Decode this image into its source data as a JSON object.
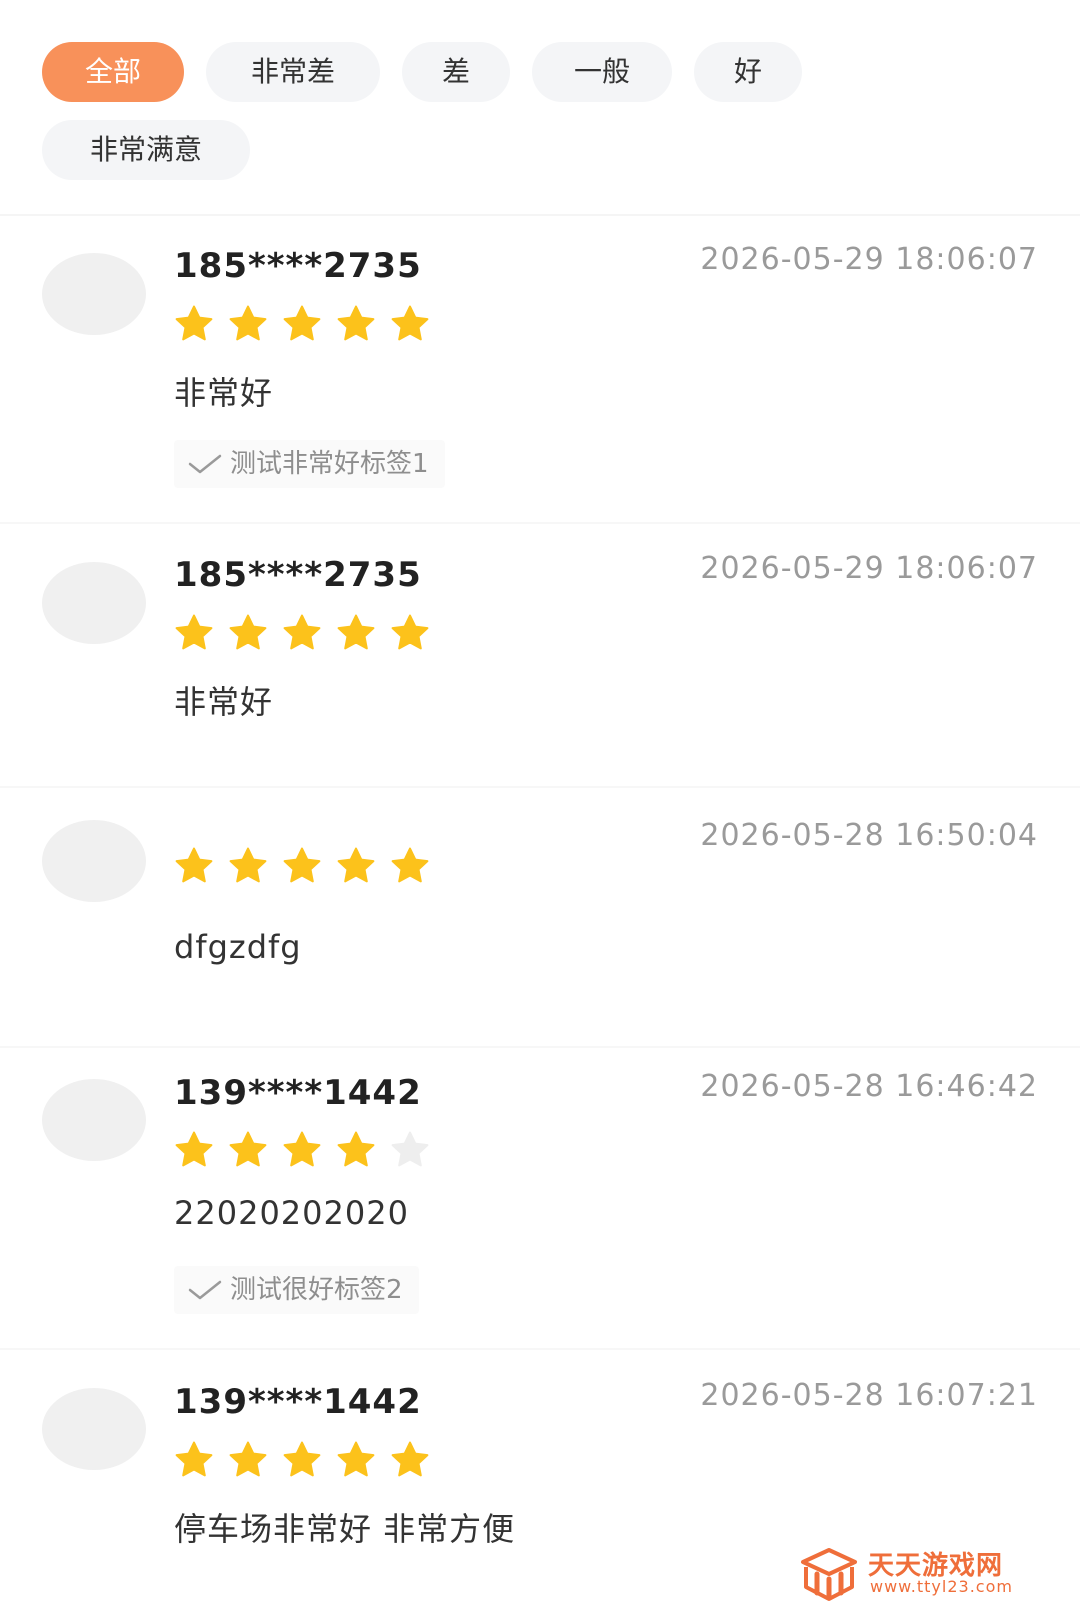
{
  "filters": [
    {
      "label": "全部",
      "active": true
    },
    {
      "label": "非常差",
      "active": false
    },
    {
      "label": "差",
      "active": false
    },
    {
      "label": "一般",
      "active": false
    },
    {
      "label": "好",
      "active": false
    },
    {
      "label": "非常满意",
      "active": false
    }
  ],
  "reviews": [
    {
      "user": "185****2735",
      "time": "2026-05-29 18:06:07",
      "rating": 5,
      "content": "非常好",
      "tag": "测试非常好标签1"
    },
    {
      "user": "185****2735",
      "time": "2026-05-29 18:06:07",
      "rating": 5,
      "content": "非常好",
      "tag": ""
    },
    {
      "user": "",
      "time": "2026-05-28 16:50:04",
      "rating": 5,
      "content": "dfgzdfg",
      "tag": ""
    },
    {
      "user": "139****1442",
      "time": "2026-05-28 16:46:42",
      "rating": 4,
      "content": "22020202020",
      "tag": "测试很好标签2"
    },
    {
      "user": "139****1442",
      "time": "2026-05-28 16:07:21",
      "rating": 5,
      "content": "停车场非常好 非常方便",
      "tag": ""
    }
  ],
  "watermark": {
    "title": "天天游戏网",
    "url": "www.ttyl23.com"
  },
  "colors": {
    "accent": "#f8915a",
    "star_filled": "#fcc21b",
    "star_empty": "#eeeeee"
  },
  "icons": {
    "star": "star-icon",
    "check": "check-icon",
    "logo": "site-logo-icon"
  }
}
